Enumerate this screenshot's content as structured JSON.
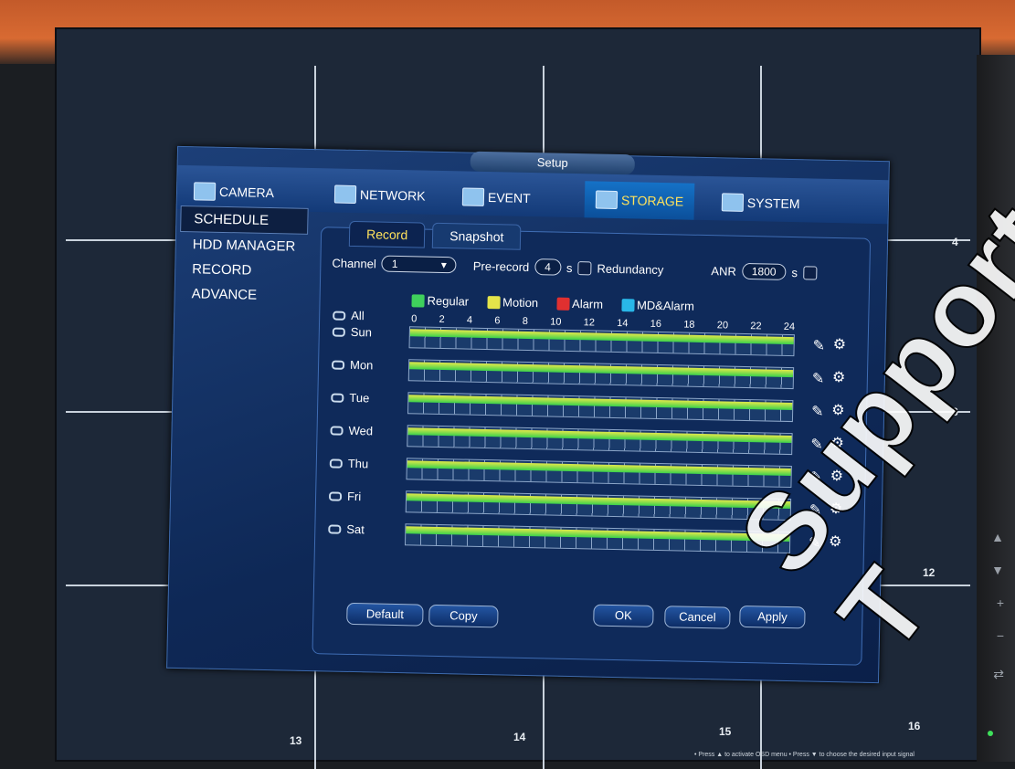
{
  "dialog": {
    "title": "Setup",
    "tabs": [
      {
        "label": "CAMERA",
        "active": false
      },
      {
        "label": "NETWORK",
        "active": false
      },
      {
        "label": "EVENT",
        "active": false
      },
      {
        "label": "STORAGE",
        "active": true
      },
      {
        "label": "SYSTEM",
        "active": false
      }
    ],
    "sidebar": [
      "SCHEDULE",
      "HDD MANAGER",
      "RECORD",
      "ADVANCE"
    ],
    "subtabs": [
      "Record",
      "Snapshot"
    ],
    "channel_label": "Channel",
    "channel_value": "1",
    "prerecord_label": "Pre-record",
    "prerecord_value": "4",
    "seconds_unit": "s",
    "redundancy_label": "Redundancy",
    "anr_label": "ANR",
    "anr_value": "1800",
    "legend": [
      {
        "label": "Regular",
        "color": "#3fd05c"
      },
      {
        "label": "Motion",
        "color": "#e4e44a"
      },
      {
        "label": "Alarm",
        "color": "#e03030"
      },
      {
        "label": "MD&Alarm",
        "color": "#29b7e8"
      }
    ],
    "all_label": "All",
    "hours": [
      "0",
      "2",
      "4",
      "6",
      "8",
      "10",
      "12",
      "14",
      "16",
      "18",
      "20",
      "22",
      "24"
    ],
    "days": [
      "Sun",
      "Mon",
      "Tue",
      "Wed",
      "Thu",
      "Fri",
      "Sat"
    ],
    "buttons": {
      "default": "Default",
      "copy": "Copy",
      "ok": "OK",
      "cancel": "Cancel",
      "apply": "Apply"
    }
  },
  "monitor": {
    "cell_numbers": [
      "4",
      "8",
      "12",
      "13",
      "14",
      "15",
      "16"
    ],
    "osd_hint": "• Press ▲ to activate OSD menu  • Press ▼ to choose the desired input signal"
  },
  "watermark": "Support T"
}
